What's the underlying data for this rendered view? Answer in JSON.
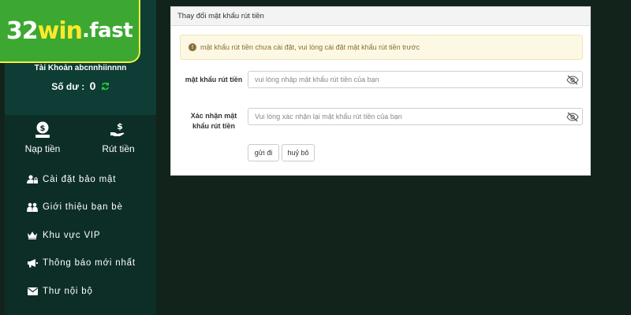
{
  "logo": {
    "num": "32",
    "win": "win",
    "fast": ".fast"
  },
  "account": {
    "label": "Tài Khoản abcnnhiinnnn",
    "balance_label": "Số dư :",
    "balance_value": "0"
  },
  "quick_actions": [
    {
      "label": "Nạp tiền",
      "icon": "deposit-icon"
    },
    {
      "label": "Rút tiền",
      "icon": "withdraw-icon"
    }
  ],
  "menu": [
    {
      "label": "Cài đặt bảo mật",
      "icon": "user-lock-icon"
    },
    {
      "label": "Giới thiệu bạn bè",
      "icon": "friends-icon"
    },
    {
      "label": "Khu vực VIP",
      "icon": "crown-icon"
    },
    {
      "label": "Thông báo mới nhất",
      "icon": "megaphone-icon"
    },
    {
      "label": "Thư nội bộ",
      "icon": "envelope-icon"
    }
  ],
  "panel": {
    "title": "Thay đổi mật khẩu rút tiền",
    "alert": "mật khẩu rút tiền chưa cài đặt, vui lòng cài đặt mật khẩu rút tiền trước",
    "field1_label": "mật khẩu rút tiền",
    "field1_placeholder": "vui lòng nhập mật khẩu rút tiền của bạn",
    "field1_value": "",
    "field2_label": "Xác nhận mật khẩu rút tiền",
    "field2_placeholder": "Vui lòng xác nhận lại mật khẩu rút tiền của bạn",
    "field2_value": "",
    "submit_label": "gửi đi",
    "cancel_label": "huỷ bỏ"
  },
  "colors": {
    "page_bg": "#12231b",
    "sidebar_bg": "#0d2e27",
    "account_bg": "#0d3d35",
    "logo_green": "#3ca832",
    "logo_yellow": "#ffe92a",
    "refresh_green": "#2ed33b",
    "alert_bg": "#fcf8e3",
    "alert_text": "#8a6d3b"
  }
}
